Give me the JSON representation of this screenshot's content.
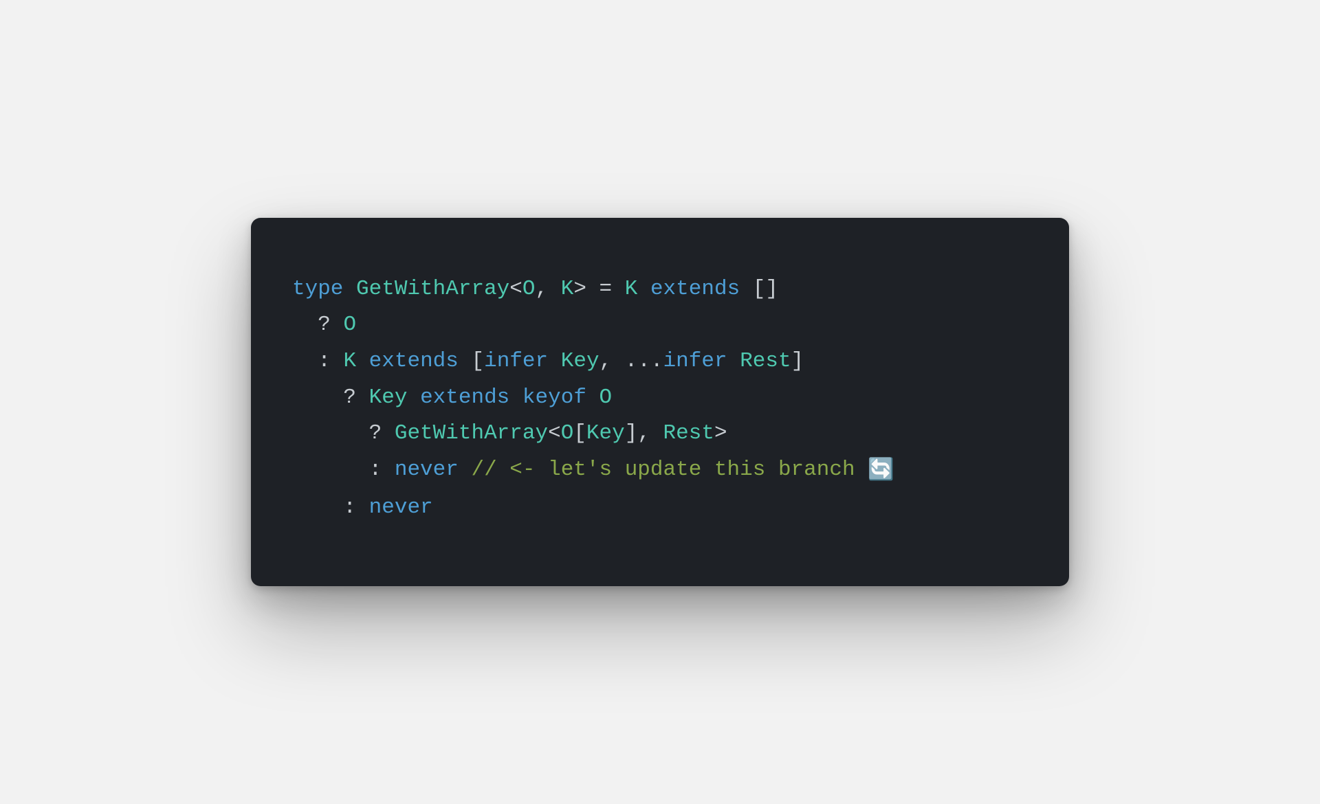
{
  "code": {
    "lines": [
      {
        "indent": 0,
        "tokens": [
          {
            "t": "type ",
            "c": "tok-keyword"
          },
          {
            "t": "GetWithArray",
            "c": "tok-typename"
          },
          {
            "t": "<",
            "c": "tok-punct"
          },
          {
            "t": "O",
            "c": "tok-typeparam"
          },
          {
            "t": ", ",
            "c": "tok-punct"
          },
          {
            "t": "K",
            "c": "tok-typeparam"
          },
          {
            "t": "> = ",
            "c": "tok-punct"
          },
          {
            "t": "K",
            "c": "tok-typeparam"
          },
          {
            "t": " ",
            "c": "tok-punct"
          },
          {
            "t": "extends",
            "c": "tok-keyword"
          },
          {
            "t": " []",
            "c": "tok-punct"
          }
        ]
      },
      {
        "indent": 2,
        "tokens": [
          {
            "t": "? ",
            "c": "tok-punct"
          },
          {
            "t": "O",
            "c": "tok-typeparam"
          }
        ]
      },
      {
        "indent": 2,
        "tokens": [
          {
            "t": ": ",
            "c": "tok-punct"
          },
          {
            "t": "K",
            "c": "tok-typeparam"
          },
          {
            "t": " ",
            "c": "tok-punct"
          },
          {
            "t": "extends",
            "c": "tok-keyword"
          },
          {
            "t": " [",
            "c": "tok-punct"
          },
          {
            "t": "infer",
            "c": "tok-keyword"
          },
          {
            "t": " ",
            "c": "tok-punct"
          },
          {
            "t": "Key",
            "c": "tok-typename"
          },
          {
            "t": ", ...",
            "c": "tok-punct"
          },
          {
            "t": "infer",
            "c": "tok-keyword"
          },
          {
            "t": " ",
            "c": "tok-punct"
          },
          {
            "t": "Rest",
            "c": "tok-typename"
          },
          {
            "t": "]",
            "c": "tok-punct"
          }
        ]
      },
      {
        "indent": 4,
        "tokens": [
          {
            "t": "? ",
            "c": "tok-punct"
          },
          {
            "t": "Key",
            "c": "tok-typename"
          },
          {
            "t": " ",
            "c": "tok-punct"
          },
          {
            "t": "extends",
            "c": "tok-keyword"
          },
          {
            "t": " ",
            "c": "tok-punct"
          },
          {
            "t": "keyof",
            "c": "tok-keyword"
          },
          {
            "t": " ",
            "c": "tok-punct"
          },
          {
            "t": "O",
            "c": "tok-typeparam"
          }
        ]
      },
      {
        "indent": 6,
        "tokens": [
          {
            "t": "? ",
            "c": "tok-punct"
          },
          {
            "t": "GetWithArray",
            "c": "tok-typename"
          },
          {
            "t": "<",
            "c": "tok-punct"
          },
          {
            "t": "O",
            "c": "tok-typeparam"
          },
          {
            "t": "[",
            "c": "tok-punct"
          },
          {
            "t": "Key",
            "c": "tok-typename"
          },
          {
            "t": "], ",
            "c": "tok-punct"
          },
          {
            "t": "Rest",
            "c": "tok-typename"
          },
          {
            "t": ">",
            "c": "tok-punct"
          }
        ]
      },
      {
        "indent": 6,
        "tokens": [
          {
            "t": ": ",
            "c": "tok-punct"
          },
          {
            "t": "never",
            "c": "tok-keyword"
          },
          {
            "t": " ",
            "c": "tok-punct"
          },
          {
            "t": "// <- let's update this branch ",
            "c": "tok-comment"
          },
          {
            "t": "🔄",
            "c": "emoji"
          }
        ]
      },
      {
        "indent": 4,
        "tokens": [
          {
            "t": ": ",
            "c": "tok-punct"
          },
          {
            "t": "never",
            "c": "tok-keyword"
          }
        ]
      }
    ]
  }
}
